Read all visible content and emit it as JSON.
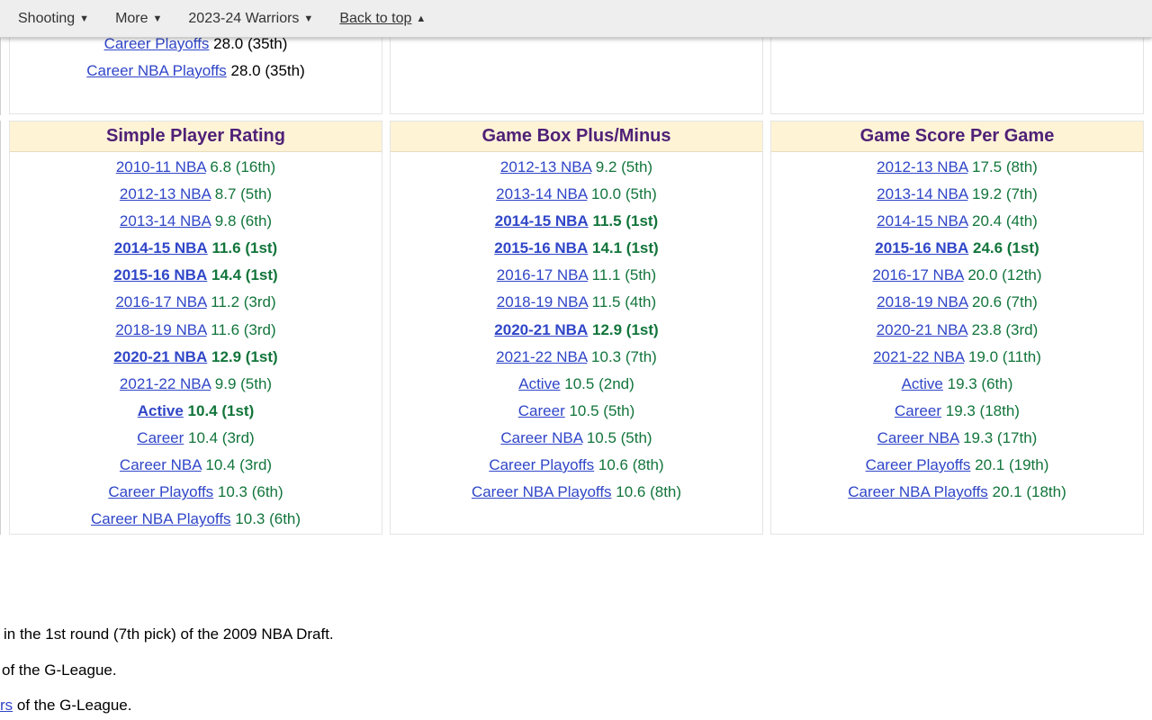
{
  "nav": {
    "items": [
      {
        "label": "Shooting",
        "caret": "▼"
      },
      {
        "label": "More",
        "caret": "▼"
      },
      {
        "label": "2023-24 Warriors",
        "caret": "▼"
      },
      {
        "label": "Back to top",
        "caret": "▲"
      }
    ]
  },
  "top_partial": {
    "rows": [
      {
        "link": "Career Playoffs",
        "value": "28.0 (35th)"
      },
      {
        "link": "Career NBA Playoffs",
        "value": "28.0 (35th)"
      }
    ]
  },
  "boxes": [
    {
      "title": "Simple Player Rating",
      "rows": [
        {
          "link": "2010-11 NBA",
          "value": "6.8 (16th)",
          "lead": false
        },
        {
          "link": "2012-13 NBA",
          "value": "8.7 (5th)",
          "lead": false
        },
        {
          "link": "2013-14 NBA",
          "value": "9.8 (6th)",
          "lead": false
        },
        {
          "link": "2014-15 NBA",
          "value": "11.6 (1st)",
          "lead": true
        },
        {
          "link": "2015-16 NBA",
          "value": "14.4 (1st)",
          "lead": true
        },
        {
          "link": "2016-17 NBA",
          "value": "11.2 (3rd)",
          "lead": false
        },
        {
          "link": "2018-19 NBA",
          "value": "11.6 (3rd)",
          "lead": false
        },
        {
          "link": "2020-21 NBA",
          "value": "12.9 (1st)",
          "lead": true
        },
        {
          "link": "2021-22 NBA",
          "value": "9.9 (5th)",
          "lead": false
        },
        {
          "link": "Active",
          "value": "10.4 (1st)",
          "lead": true
        },
        {
          "link": "Career",
          "value": "10.4 (3rd)",
          "lead": false
        },
        {
          "link": "Career NBA",
          "value": "10.4 (3rd)",
          "lead": false
        },
        {
          "link": "Career Playoffs",
          "value": "10.3 (6th)",
          "lead": false
        },
        {
          "link": "Career NBA Playoffs",
          "value": "10.3 (6th)",
          "lead": false
        }
      ]
    },
    {
      "title": "Game Box Plus/Minus",
      "rows": [
        {
          "link": "2012-13 NBA",
          "value": "9.2 (5th)",
          "lead": false
        },
        {
          "link": "2013-14 NBA",
          "value": "10.0 (5th)",
          "lead": false
        },
        {
          "link": "2014-15 NBA",
          "value": "11.5 (1st)",
          "lead": true
        },
        {
          "link": "2015-16 NBA",
          "value": "14.1 (1st)",
          "lead": true
        },
        {
          "link": "2016-17 NBA",
          "value": "11.1 (5th)",
          "lead": false
        },
        {
          "link": "2018-19 NBA",
          "value": "11.5 (4th)",
          "lead": false
        },
        {
          "link": "2020-21 NBA",
          "value": "12.9 (1st)",
          "lead": true
        },
        {
          "link": "2021-22 NBA",
          "value": "10.3 (7th)",
          "lead": false
        },
        {
          "link": "Active",
          "value": "10.5 (2nd)",
          "lead": false
        },
        {
          "link": "Career",
          "value": "10.5 (5th)",
          "lead": false
        },
        {
          "link": "Career NBA",
          "value": "10.5 (5th)",
          "lead": false
        },
        {
          "link": "Career Playoffs",
          "value": "10.6 (8th)",
          "lead": false
        },
        {
          "link": "Career NBA Playoffs",
          "value": "10.6 (8th)",
          "lead": false
        }
      ]
    },
    {
      "title": "Game Score Per Game",
      "rows": [
        {
          "link": "2012-13 NBA",
          "value": "17.5 (8th)",
          "lead": false
        },
        {
          "link": "2013-14 NBA",
          "value": "19.2 (7th)",
          "lead": false
        },
        {
          "link": "2014-15 NBA",
          "value": "20.4 (4th)",
          "lead": false
        },
        {
          "link": "2015-16 NBA",
          "value": "24.6 (1st)",
          "lead": true
        },
        {
          "link": "2016-17 NBA",
          "value": "20.0 (12th)",
          "lead": false
        },
        {
          "link": "2018-19 NBA",
          "value": "20.6 (7th)",
          "lead": false
        },
        {
          "link": "2020-21 NBA",
          "value": "23.8 (3rd)",
          "lead": false
        },
        {
          "link": "2021-22 NBA",
          "value": "19.0 (11th)",
          "lead": false
        },
        {
          "link": "Active",
          "value": "19.3 (6th)",
          "lead": false
        },
        {
          "link": "Career",
          "value": "19.3 (18th)",
          "lead": false
        },
        {
          "link": "Career NBA",
          "value": "19.3 (17th)",
          "lead": false
        },
        {
          "link": "Career Playoffs",
          "value": "20.1 (19th)",
          "lead": false
        },
        {
          "link": "Career NBA Playoffs",
          "value": "20.1 (18th)",
          "lead": false
        }
      ]
    }
  ],
  "bio": {
    "line1": "in the 1st round (7th pick) of the 2009 NBA Draft.",
    "line2": "of the G-League.",
    "line3_link": "rs",
    "line3_text": " of the G-League."
  },
  "colors": {
    "header_bg": "#fff3d6",
    "header_text": "#4f2177",
    "link": "#3046c8",
    "value": "#12753b"
  }
}
